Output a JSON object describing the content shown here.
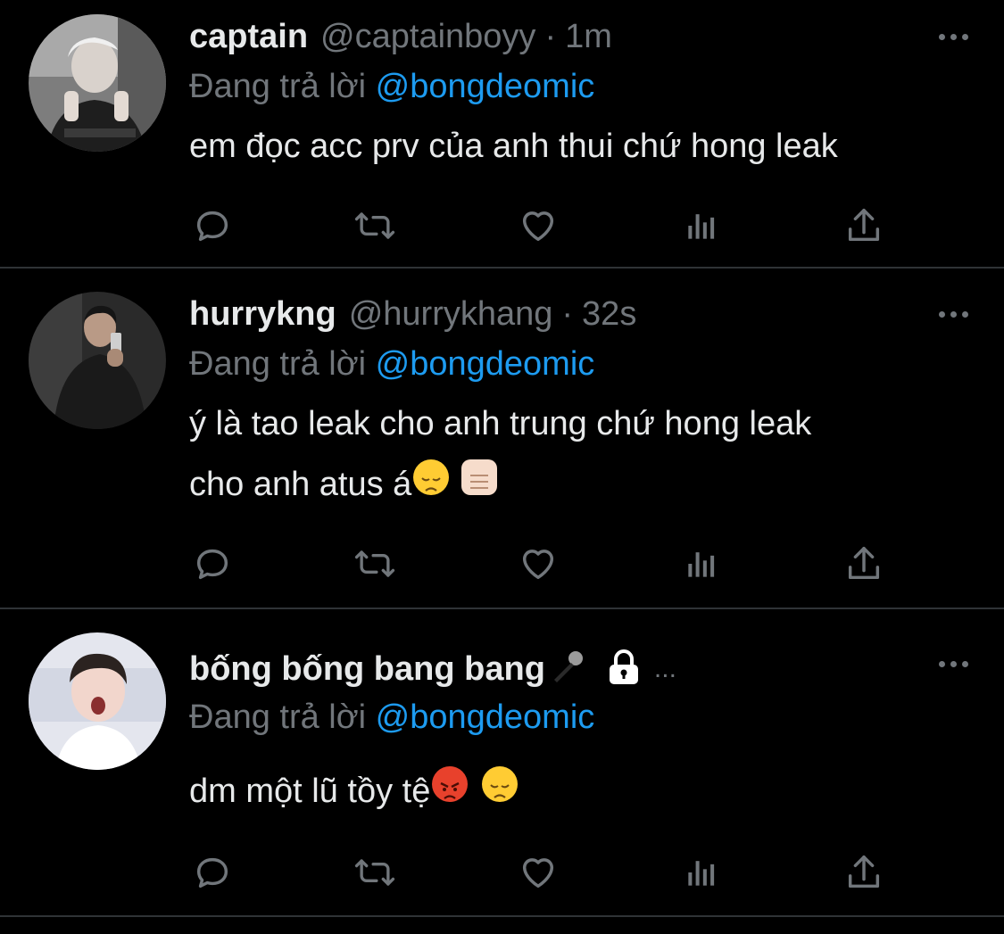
{
  "colors": {
    "accent": "#1d9bf0",
    "muted": "#71767b",
    "text": "#e7e9ea",
    "divider": "#2f3336"
  },
  "tweets": [
    {
      "name": "captain",
      "handle": "@captainboyy",
      "separator": "·",
      "time": "1m",
      "reply_prefix": "Đang trả lời",
      "reply_to": "@bongdeomic",
      "text_lines": [
        "em đọc acc prv của anh thui chứ hong leak"
      ],
      "avatar_icon": "person-photo-avatar"
    },
    {
      "name": "hurrykng",
      "handle": "@hurrykhang",
      "separator": "·",
      "time": "32s",
      "reply_prefix": "Đang trả lời",
      "reply_to": "@bongdeomic",
      "text_lines": [
        "ý là tao leak cho anh trung chứ hong leak",
        "cho anh atus á"
      ],
      "emojis": [
        "disappointed-face",
        "oncoming-fist"
      ],
      "avatar_icon": "mirror-selfie-avatar"
    },
    {
      "name": "bống bống bang bang",
      "name_emoji": "microphone",
      "locked_icon": "lock-icon",
      "ellipsis": "...",
      "reply_prefix": "Đang trả lời",
      "reply_to": "@bongdeomic",
      "text_lines": [
        "dm một lũ tồy tệ"
      ],
      "emojis": [
        "angry-face",
        "disappointed-face"
      ],
      "avatar_icon": "person-portrait-avatar"
    }
  ],
  "actions": [
    "reply-icon",
    "retweet-icon",
    "like-icon",
    "views-icon",
    "share-icon"
  ]
}
